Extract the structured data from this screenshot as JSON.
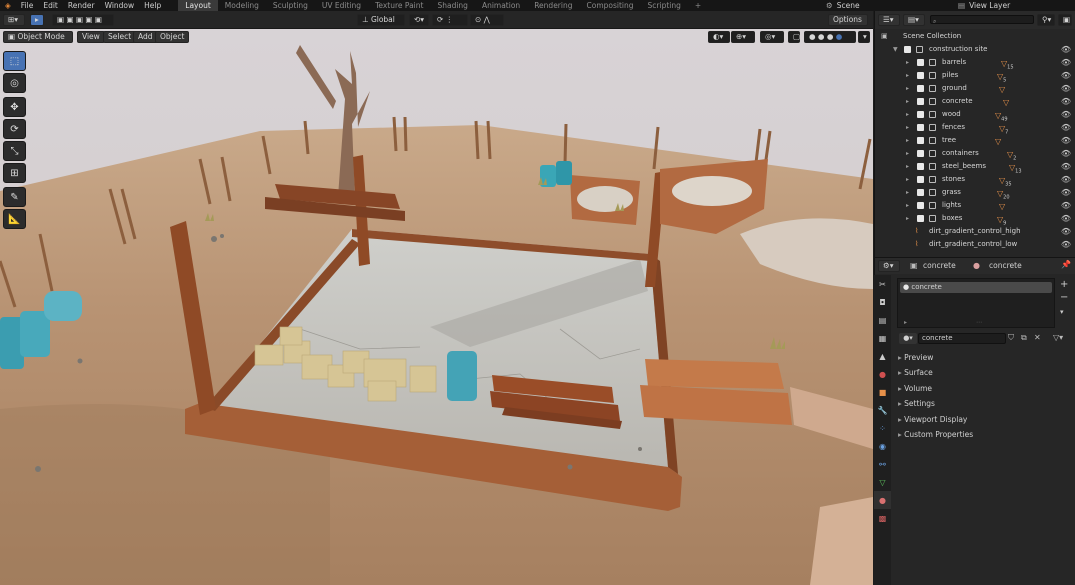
{
  "topbar": {
    "menus": [
      "File",
      "Edit",
      "Render",
      "Window",
      "Help"
    ],
    "workspaces": [
      "Layout",
      "Modeling",
      "Sculpting",
      "UV Editing",
      "Texture Paint",
      "Shading",
      "Animation",
      "Rendering",
      "Compositing",
      "Scripting"
    ],
    "active_workspace": "Layout",
    "add_workspace": "+",
    "scene": "Scene",
    "view_layer": "View Layer"
  },
  "viewport_header": {
    "mode": "Object Mode",
    "menus": [
      "View",
      "Select",
      "Add",
      "Object"
    ],
    "orientation": "Global",
    "options": "Options"
  },
  "tools": [
    "select-box-icon",
    "cursor-icon",
    "move-icon",
    "rotate-icon",
    "scale-icon",
    "transform-icon",
    "annotate-icon",
    "measure-icon"
  ],
  "outliner": {
    "root": "Scene Collection",
    "collection": "construction site",
    "items": [
      {
        "name": "barrels",
        "count": "15"
      },
      {
        "name": "piles",
        "count": "5"
      },
      {
        "name": "ground",
        "count": ""
      },
      {
        "name": "concrete",
        "count": ""
      },
      {
        "name": "wood",
        "count": "49"
      },
      {
        "name": "fences",
        "count": "7"
      },
      {
        "name": "tree",
        "count": ""
      },
      {
        "name": "containers",
        "count": "2"
      },
      {
        "name": "steel_beems",
        "count": "13"
      },
      {
        "name": "stones",
        "count": "35"
      },
      {
        "name": "grass",
        "count": "20"
      },
      {
        "name": "lights",
        "count": ""
      },
      {
        "name": "boxes",
        "count": "9"
      }
    ],
    "empties": [
      "dirt_gradient_control_high",
      "dirt_gradient_control_low"
    ]
  },
  "properties": {
    "object": "concrete",
    "material": "concrete",
    "slot": "concrete",
    "material_field": "concrete",
    "sections": [
      "Preview",
      "Surface",
      "Volume",
      "Settings",
      "Viewport Display",
      "Custom Properties"
    ]
  },
  "colors": {
    "accent": "#4772b3",
    "panel": "#262626",
    "sky": "#d8d4d6",
    "ground": "#b08c66",
    "rust": "#9a5530"
  }
}
